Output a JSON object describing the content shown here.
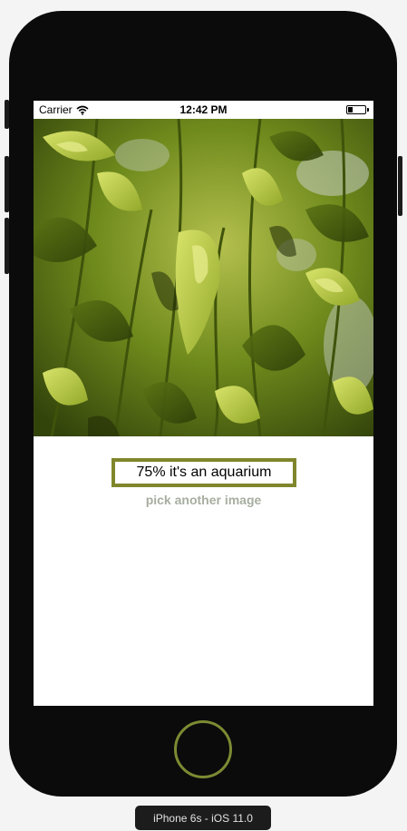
{
  "status_bar": {
    "carrier": "Carrier",
    "time": "12:42 PM",
    "wifi_icon": "wifi-icon",
    "battery_icon": "battery-icon",
    "battery_level": 0.25
  },
  "photo": {
    "description_icon": "leaves-photo"
  },
  "result": {
    "label": "75% it's an aquarium"
  },
  "actions": {
    "pick_label": "pick another image"
  },
  "device": {
    "label": "iPhone 6s - iOS 11.0"
  },
  "colors": {
    "accent": "#7f862c",
    "link": "#a7aea0",
    "home_ring": "#7d8a32",
    "frame": "#0b0b0b"
  }
}
